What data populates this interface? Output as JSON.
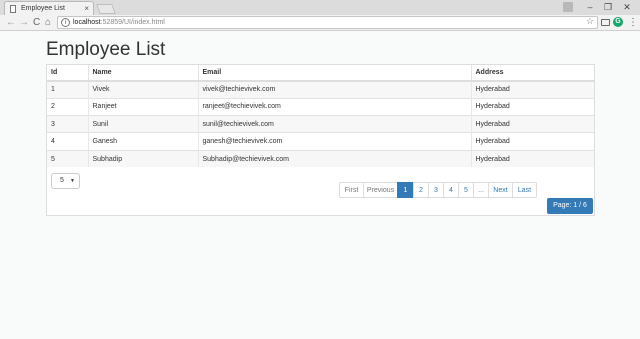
{
  "browser": {
    "tab_title": "Employee List",
    "tab_close": "×",
    "url_host": "localhost",
    "url_path": ":52859/UI/index.html",
    "window_controls": [
      "–",
      "❐",
      "✕"
    ],
    "nav": [
      "←",
      "→",
      "C",
      "⌂"
    ],
    "star": "☆",
    "menu": "⋮"
  },
  "page": {
    "title": "Employee List",
    "columns": [
      "Id",
      "Name",
      "Email",
      "Address"
    ],
    "rows": [
      [
        "1",
        "Vivek",
        "vivek@techievivek.com",
        "Hyderabad"
      ],
      [
        "2",
        "Ranjeet",
        "ranjeet@techievivek.com",
        "Hyderabad"
      ],
      [
        "3",
        "Sunil",
        "sunil@techievivek.com",
        "Hyderabad"
      ],
      [
        "4",
        "Ganesh",
        "ganesh@techievivek.com",
        "Hyderabad"
      ],
      [
        "5",
        "Subhadip",
        "Subhadip@techievivek.com",
        "Hyderabad"
      ]
    ],
    "page_size": "5",
    "pager": [
      "First",
      "Previous",
      "1",
      "2",
      "3",
      "4",
      "5",
      "...",
      "Next",
      "Last"
    ],
    "active_page": "1",
    "page_label": "Page: 1 / 6"
  },
  "colors": {
    "primary": "#337ab7",
    "page_bg": "#f9fbfa"
  }
}
